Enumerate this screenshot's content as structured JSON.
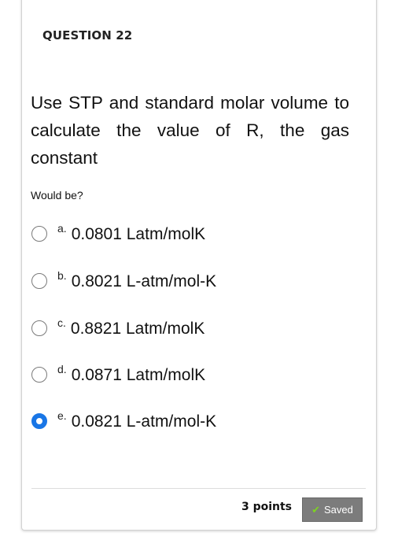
{
  "question": {
    "header": "QUESTION 22",
    "text": "Use STP and standard molar volume to calculate the value of R, the gas constant",
    "subtext": "Would be?"
  },
  "options": [
    {
      "letter": "a.",
      "text": "0.0801 Latm/molK",
      "selected": false
    },
    {
      "letter": "b.",
      "text": "0.8021 L-atm/mol-K",
      "selected": false
    },
    {
      "letter": "c.",
      "text": "0.8821 Latm/molK",
      "selected": false
    },
    {
      "letter": "d.",
      "text": "0.0871 Latm/molK",
      "selected": false
    },
    {
      "letter": "e.",
      "text": "0.0821 L-atm/mol-K",
      "selected": true
    }
  ],
  "footer": {
    "points": "3 points",
    "saved_label": "Saved",
    "saved_icon": "check-icon"
  },
  "colors": {
    "radio_selected": "#1976e6",
    "saved_bg": "#7c7c7c",
    "check": "#7ed321"
  }
}
